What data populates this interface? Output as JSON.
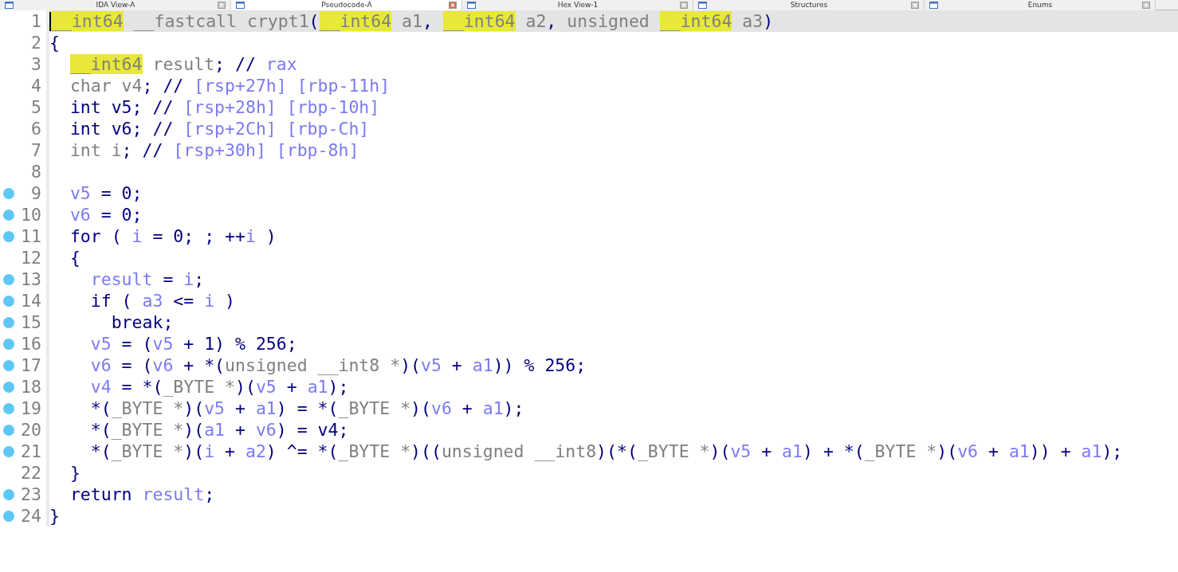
{
  "tabs": [
    {
      "label": "IDA View-A",
      "selected": false
    },
    {
      "label": "Pseudocode-A",
      "selected": true
    },
    {
      "label": "Hex View-1",
      "selected": false
    },
    {
      "label": "Structures",
      "selected": false
    },
    {
      "label": "Enums",
      "selected": false
    }
  ],
  "lines": [
    {
      "number": "1",
      "breakpoint": false,
      "selected": true,
      "segments": [
        {
          "text": "__int64",
          "kind": "hl"
        },
        {
          "text": " __fastcall crypt1",
          "kind": "pl"
        },
        {
          "text": "(",
          "kind": "op"
        },
        {
          "text": "__int64",
          "kind": "hl"
        },
        {
          "text": " a1",
          "kind": "pl"
        },
        {
          "text": ", ",
          "kind": "op"
        },
        {
          "text": "__int64",
          "kind": "hl"
        },
        {
          "text": " a2",
          "kind": "pl"
        },
        {
          "text": ", ",
          "kind": "op"
        },
        {
          "text": "unsigned ",
          "kind": "pl"
        },
        {
          "text": "__int64",
          "kind": "hl"
        },
        {
          "text": " a3",
          "kind": "pl"
        },
        {
          "text": ")",
          "kind": "op"
        }
      ]
    },
    {
      "number": "2",
      "breakpoint": false,
      "selected": false,
      "segments": [
        {
          "text": "{",
          "kind": "op"
        }
      ]
    },
    {
      "number": "3",
      "breakpoint": false,
      "selected": false,
      "segments": [
        {
          "text": "  __int64",
          "kind": "hl"
        },
        {
          "text": " result",
          "kind": "pl"
        },
        {
          "text": "; // ",
          "kind": "op"
        },
        {
          "text": "rax",
          "kind": "var"
        }
      ]
    },
    {
      "number": "4",
      "breakpoint": false,
      "selected": false,
      "segments": [
        {
          "text": "  char v4",
          "kind": "pl"
        },
        {
          "text": "; // ",
          "kind": "op"
        },
        {
          "text": "[rsp+27h] [rbp-11h]",
          "kind": "var"
        }
      ]
    },
    {
      "number": "5",
      "breakpoint": false,
      "selected": false,
      "segments": [
        {
          "text": "  int v5; // ",
          "kind": "op"
        },
        {
          "text": "[rsp+28h] [rbp-10h]",
          "kind": "var"
        }
      ]
    },
    {
      "number": "6",
      "breakpoint": false,
      "selected": false,
      "segments": [
        {
          "text": "  int v6; // ",
          "kind": "op"
        },
        {
          "text": "[rsp+2Ch] [rbp-Ch]",
          "kind": "var"
        }
      ]
    },
    {
      "number": "7",
      "breakpoint": false,
      "selected": false,
      "segments": [
        {
          "text": "  int i",
          "kind": "pl"
        },
        {
          "text": "; // ",
          "kind": "op"
        },
        {
          "text": "[rsp+30h] [rbp-8h]",
          "kind": "var"
        }
      ]
    },
    {
      "number": "8",
      "breakpoint": false,
      "selected": false
    },
    {
      "number": "9",
      "breakpoint": true,
      "selected": false,
      "segments": [
        {
          "text": "  v5",
          "kind": "var"
        },
        {
          "text": " = 0;",
          "kind": "op"
        }
      ]
    },
    {
      "number": "10",
      "breakpoint": true,
      "selected": false,
      "segments": [
        {
          "text": "  v6",
          "kind": "var"
        },
        {
          "text": " = 0;",
          "kind": "op"
        }
      ]
    },
    {
      "number": "11",
      "breakpoint": true,
      "selected": false,
      "segments": [
        {
          "text": "  for ( ",
          "kind": "op"
        },
        {
          "text": "i",
          "kind": "var"
        },
        {
          "text": " = 0; ; ++",
          "kind": "op"
        },
        {
          "text": "i",
          "kind": "var"
        },
        {
          "text": " )",
          "kind": "op"
        }
      ]
    },
    {
      "number": "12",
      "breakpoint": false,
      "selected": false,
      "segments": [
        {
          "text": "  {",
          "kind": "op"
        }
      ]
    },
    {
      "number": "13",
      "breakpoint": true,
      "selected": false,
      "segments": [
        {
          "text": "    result",
          "kind": "var"
        },
        {
          "text": " = ",
          "kind": "op"
        },
        {
          "text": "i",
          "kind": "var"
        },
        {
          "text": ";",
          "kind": "op"
        }
      ]
    },
    {
      "number": "14",
      "breakpoint": true,
      "selected": false,
      "segments": [
        {
          "text": "    if ( ",
          "kind": "op"
        },
        {
          "text": "a3",
          "kind": "var"
        },
        {
          "text": " <= ",
          "kind": "op"
        },
        {
          "text": "i",
          "kind": "var"
        },
        {
          "text": " )",
          "kind": "op"
        }
      ]
    },
    {
      "number": "15",
      "breakpoint": true,
      "selected": false,
      "segments": [
        {
          "text": "      break;",
          "kind": "op"
        }
      ]
    },
    {
      "number": "16",
      "breakpoint": true,
      "selected": false,
      "segments": [
        {
          "text": "    v5",
          "kind": "var"
        },
        {
          "text": " = (",
          "kind": "op"
        },
        {
          "text": "v5",
          "kind": "var"
        },
        {
          "text": " + 1) % 256;",
          "kind": "op"
        }
      ]
    },
    {
      "number": "17",
      "breakpoint": true,
      "selected": false,
      "segments": [
        {
          "text": "    v6",
          "kind": "var"
        },
        {
          "text": " = (",
          "kind": "op"
        },
        {
          "text": "v6",
          "kind": "var"
        },
        {
          "text": " + *(",
          "kind": "op"
        },
        {
          "text": "unsigned __int8 *",
          "kind": "pl"
        },
        {
          "text": ")(",
          "kind": "op"
        },
        {
          "text": "v5",
          "kind": "var"
        },
        {
          "text": " + ",
          "kind": "op"
        },
        {
          "text": "a1",
          "kind": "var"
        },
        {
          "text": ")) % 256;",
          "kind": "op"
        }
      ]
    },
    {
      "number": "18",
      "breakpoint": true,
      "selected": false,
      "segments": [
        {
          "text": "    v4",
          "kind": "var"
        },
        {
          "text": " = *(",
          "kind": "op"
        },
        {
          "text": "_BYTE *",
          "kind": "pl"
        },
        {
          "text": ")(",
          "kind": "op"
        },
        {
          "text": "v5",
          "kind": "var"
        },
        {
          "text": " + ",
          "kind": "op"
        },
        {
          "text": "a1",
          "kind": "var"
        },
        {
          "text": ");",
          "kind": "op"
        }
      ]
    },
    {
      "number": "19",
      "breakpoint": true,
      "selected": false,
      "segments": [
        {
          "text": "    *(",
          "kind": "op"
        },
        {
          "text": "_BYTE *",
          "kind": "pl"
        },
        {
          "text": ")(",
          "kind": "op"
        },
        {
          "text": "v5",
          "kind": "var"
        },
        {
          "text": " + ",
          "kind": "op"
        },
        {
          "text": "a1",
          "kind": "var"
        },
        {
          "text": ") = *(",
          "kind": "op"
        },
        {
          "text": "_BYTE *",
          "kind": "pl"
        },
        {
          "text": ")(",
          "kind": "op"
        },
        {
          "text": "v6",
          "kind": "var"
        },
        {
          "text": " + ",
          "kind": "op"
        },
        {
          "text": "a1",
          "kind": "var"
        },
        {
          "text": ");",
          "kind": "op"
        }
      ]
    },
    {
      "number": "20",
      "breakpoint": true,
      "selected": false,
      "segments": [
        {
          "text": "    *(",
          "kind": "op"
        },
        {
          "text": "_BYTE *",
          "kind": "pl"
        },
        {
          "text": ")(",
          "kind": "op"
        },
        {
          "text": "a1",
          "kind": "var"
        },
        {
          "text": " + ",
          "kind": "op"
        },
        {
          "text": "v6",
          "kind": "var"
        },
        {
          "text": ") = v4;",
          "kind": "op"
        }
      ]
    },
    {
      "number": "21",
      "breakpoint": true,
      "selected": false,
      "segments": [
        {
          "text": "    *(",
          "kind": "op"
        },
        {
          "text": "_BYTE *",
          "kind": "pl"
        },
        {
          "text": ")(",
          "kind": "op"
        },
        {
          "text": "i",
          "kind": "var"
        },
        {
          "text": " + ",
          "kind": "op"
        },
        {
          "text": "a2",
          "kind": "var"
        },
        {
          "text": ") ^= *(",
          "kind": "op"
        },
        {
          "text": "_BYTE *",
          "kind": "pl"
        },
        {
          "text": ")((",
          "kind": "op"
        },
        {
          "text": "unsigned __int8",
          "kind": "pl"
        },
        {
          "text": ")(*(",
          "kind": "op"
        },
        {
          "text": "_BYTE *",
          "kind": "pl"
        },
        {
          "text": ")(",
          "kind": "op"
        },
        {
          "text": "v5",
          "kind": "var"
        },
        {
          "text": " + ",
          "kind": "op"
        },
        {
          "text": "a1",
          "kind": "var"
        },
        {
          "text": ") + *(",
          "kind": "op"
        },
        {
          "text": "_BYTE *",
          "kind": "pl"
        },
        {
          "text": ")(",
          "kind": "op"
        },
        {
          "text": "v6",
          "kind": "var"
        },
        {
          "text": " + ",
          "kind": "op"
        },
        {
          "text": "a1",
          "kind": "var"
        },
        {
          "text": ")) + ",
          "kind": "op"
        },
        {
          "text": "a1",
          "kind": "var"
        },
        {
          "text": ");",
          "kind": "op"
        }
      ]
    },
    {
      "number": "22",
      "breakpoint": false,
      "selected": false,
      "segments": [
        {
          "text": "  }",
          "kind": "op"
        }
      ]
    },
    {
      "number": "23",
      "breakpoint": true,
      "selected": false,
      "segments": [
        {
          "text": "  return ",
          "kind": "op"
        },
        {
          "text": "result",
          "kind": "var"
        },
        {
          "text": ";",
          "kind": "op"
        }
      ]
    },
    {
      "number": "24",
      "breakpoint": true,
      "selected": false,
      "segments": [
        {
          "text": "}",
          "kind": "op"
        }
      ]
    }
  ]
}
